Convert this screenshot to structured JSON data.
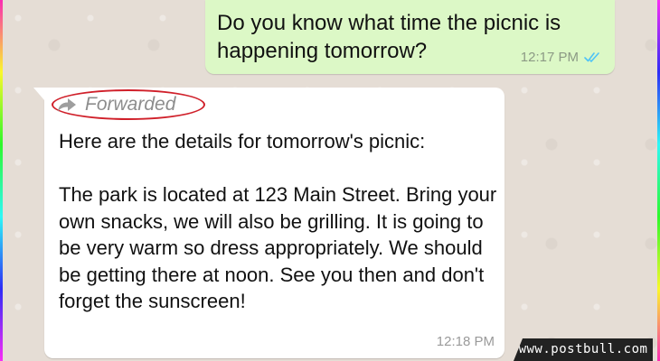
{
  "outgoing_message": {
    "text": "Do you know what time the picnic is happening tomorrow?",
    "time": "12:17 PM",
    "status_icon": "double-check-read-icon",
    "bubble_color": "#dcf8c6",
    "tick_color": "#4fc3f7"
  },
  "incoming_message": {
    "forwarded_label": "Forwarded",
    "forwarded_icon": "forward-arrow-icon",
    "text": "Here are the details for tomorrow's picnic:\n\nThe park is located at 123 Main Street. Bring your own snacks, we will also be grilling. It is going to be very warm so dress appropriately. We should be getting there at noon. See you then and don't forget the sunscreen!",
    "time": "12:18 PM",
    "bubble_color": "#ffffff"
  },
  "annotation": {
    "highlight_color": "#d0202a"
  },
  "watermark": {
    "text": "www.postbull.com"
  },
  "chat_background_color": "#e5ddd5"
}
